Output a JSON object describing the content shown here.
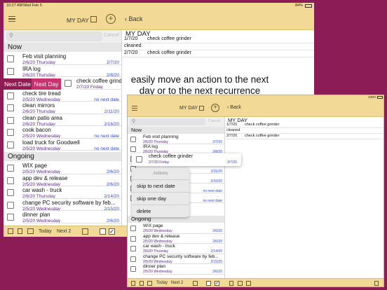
{
  "caption": {
    "line1": "easily move an action to the next",
    "line2": "day or to the next recurrence"
  },
  "big": {
    "status": {
      "time": "10:27 AM",
      "date": "Wed Feb 5",
      "battery": "84%"
    },
    "header": {
      "title": "MY DAY",
      "back_label": "Back"
    },
    "search": {
      "placeholder": "",
      "cancel": "Cancel"
    },
    "sections": {
      "now": "Now",
      "ongoing": "Ongoing"
    },
    "now_items": [
      {
        "title": "Feb visit planning",
        "date": "2/6/20 Thursday",
        "due": "2/7/20"
      },
      {
        "title": "IRA log",
        "date": "2/6/20 Thursday",
        "due": "2/8/20"
      },
      {
        "title": "check coffee grinder",
        "date": "2/7/20 Friday",
        "due": ""
      },
      {
        "title": "check tire tread",
        "date": "2/5/20 Wednesday",
        "due": "no next date"
      },
      {
        "title": "clean mirrors",
        "date": "2/6/20 Thursday",
        "due": "2/11/20"
      },
      {
        "title": "clean patio area",
        "date": "2/6/20 Thursday",
        "due": "2/16/20"
      },
      {
        "title": "cook bacon",
        "date": "2/5/20 Wednesday",
        "due": "no next date"
      },
      {
        "title": "load truck for Goodwell",
        "date": "2/5/20 Wednesday",
        "due": "no next date"
      }
    ],
    "ongoing_items": [
      {
        "title": "WIX page",
        "date": "2/5/20 Wednesday",
        "due": "2/6/20"
      },
      {
        "title": "app dev & release",
        "date": "2/5/20 Wednesday",
        "due": "2/6/20"
      },
      {
        "title": "car wash - truck",
        "date": "2/6/20 Thursday",
        "due": "2/14/20"
      },
      {
        "title": "change PC security software by feb...",
        "date": "2/5/20 Wednesday",
        "due": "2/15/20"
      },
      {
        "title": "dinner plan",
        "date": "2/5/20 Wednesday",
        "due": "2/6/20"
      }
    ],
    "swipe": {
      "next_date": "Next Date",
      "next_day": "Next Day"
    },
    "detail": {
      "title": "MY DAY",
      "lines": [
        {
          "date": "1/7/20",
          "text": "check coffee grinder"
        },
        {
          "date": "cleaned",
          "text": ""
        },
        {
          "date": "2/7/20",
          "text": "check coffee grinder"
        }
      ]
    },
    "bottombar": {
      "today": "Today",
      "next2": "Next 2"
    }
  },
  "small": {
    "status": {
      "time": "",
      "battery": "100%"
    },
    "header": {
      "title": "MY DAY",
      "back_label": "Back"
    },
    "search": {
      "cancel": "Cancel"
    },
    "sections": {
      "now": "Now",
      "ongoing": "Ongoing"
    },
    "now_items": [
      {
        "title": "Feb visit planning",
        "date": "2/6/20 Thursday",
        "due": "2/7/20"
      },
      {
        "title": "IRA log",
        "date": "2/6/20 Thursday",
        "due": "2/8/20"
      },
      {
        "title": "check tire tread",
        "date": "",
        "due": "no next date"
      },
      {
        "title": "",
        "date": "",
        "due": "2/11/20"
      },
      {
        "title": "",
        "date": "",
        "due": "2/16/20"
      },
      {
        "title": "",
        "date": "",
        "due": "no next date"
      },
      {
        "title": "",
        "date": "",
        "due": "no next date"
      }
    ],
    "ongoing_items": [
      {
        "title": "WIX page",
        "date": "2/5/20 Wednesday",
        "due": "2/6/20"
      },
      {
        "title": "app dev & release",
        "date": "2/5/20 Wednesday",
        "due": "2/6/20"
      },
      {
        "title": "car wash - truck",
        "date": "2/6/20 Thursday",
        "due": "2/14/20"
      },
      {
        "title": "change PC security software by feb...",
        "date": "2/5/20 Wednesday",
        "due": "2/15/20"
      },
      {
        "title": "dinner plan",
        "date": "2/5/20 Wednesday",
        "due": "2/6/20"
      }
    ],
    "floating": {
      "title": "check coffee grinder",
      "date": "2/7/20 Friday",
      "due": "3/7/20"
    },
    "menu": {
      "header": "Actions",
      "items": [
        "skip to next date",
        "skip one day",
        "delete"
      ]
    },
    "detail": {
      "title": "MY DAY",
      "lines": [
        {
          "date": "1/7/20",
          "text": "check coffee grinder"
        },
        {
          "date": "cleaned",
          "text": ""
        },
        {
          "date": "2/7/20",
          "text": "check coffee grinder"
        }
      ]
    },
    "bottombar": {
      "today": "Today",
      "next2": "Next 2"
    }
  },
  "colors": {
    "background": "#8c1c55",
    "toolbar": "#f2d995",
    "swipe_next_date": "#8f1c53",
    "swipe_next_day": "#c8336f",
    "date_purple": "#5b2a86",
    "due_blue": "#2f4bd0"
  }
}
